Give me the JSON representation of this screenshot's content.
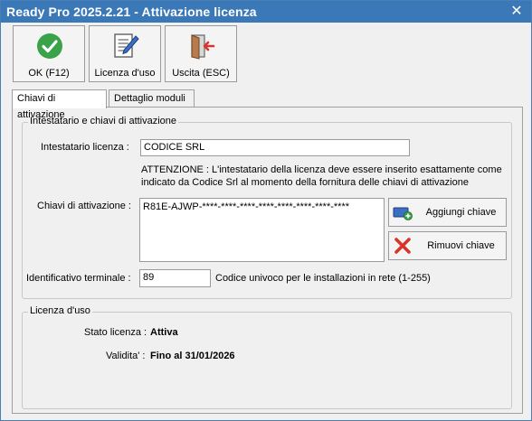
{
  "window": {
    "title": "Ready Pro 2025.2.21 - Attivazione licenza",
    "close_glyph": "✕"
  },
  "toolbar": {
    "ok_label": "OK (F12)",
    "license_label": "Licenza d'uso",
    "exit_label": "Uscita (ESC)",
    "ok_icon": "checkmark-icon",
    "license_icon": "document-edit-icon",
    "exit_icon": "exit-door-icon"
  },
  "tabs": [
    {
      "label": "Chiavi di attivazione",
      "active": true
    },
    {
      "label": "Dettaglio moduli",
      "active": false
    }
  ],
  "holder_group": {
    "title": "Intestatario e chiavi di attivazione",
    "holder_label": "Intestatario licenza :",
    "holder_value": "CODICE SRL",
    "warning": "ATTENZIONE : L'intestatario della licenza deve essere inserito esattamente come indicato da Codice Srl al momento della fornitura delle chiavi di attivazione",
    "warning_line1": "ATTENZIONE : L'intestatario della licenza deve essere inserito esattamente come",
    "warning_line2": "indicato da Codice Srl al momento della fornitura delle chiavi di attivazione",
    "keys_label": "Chiavi di attivazione :",
    "keys_value": "R81E-AJWP-****-****-****-****-****-****-****-****",
    "add_key_label": "Aggiungi chiave",
    "remove_key_label": "Rimuovi chiave",
    "terminal_label": "Identificativo terminale :",
    "terminal_value": "89",
    "terminal_hint": "Codice univoco per le installazioni in rete (1-255)"
  },
  "license_group": {
    "title": "Licenza d'uso",
    "status_label": "Stato licenza :",
    "status_value": "Attiva",
    "validity_label": "Validita' :",
    "validity_value": "Fino al 31/01/2026"
  },
  "colors": {
    "titlebar": "#3b78b8",
    "ok_green": "#3aa34a",
    "remove_red": "#d9342b"
  }
}
